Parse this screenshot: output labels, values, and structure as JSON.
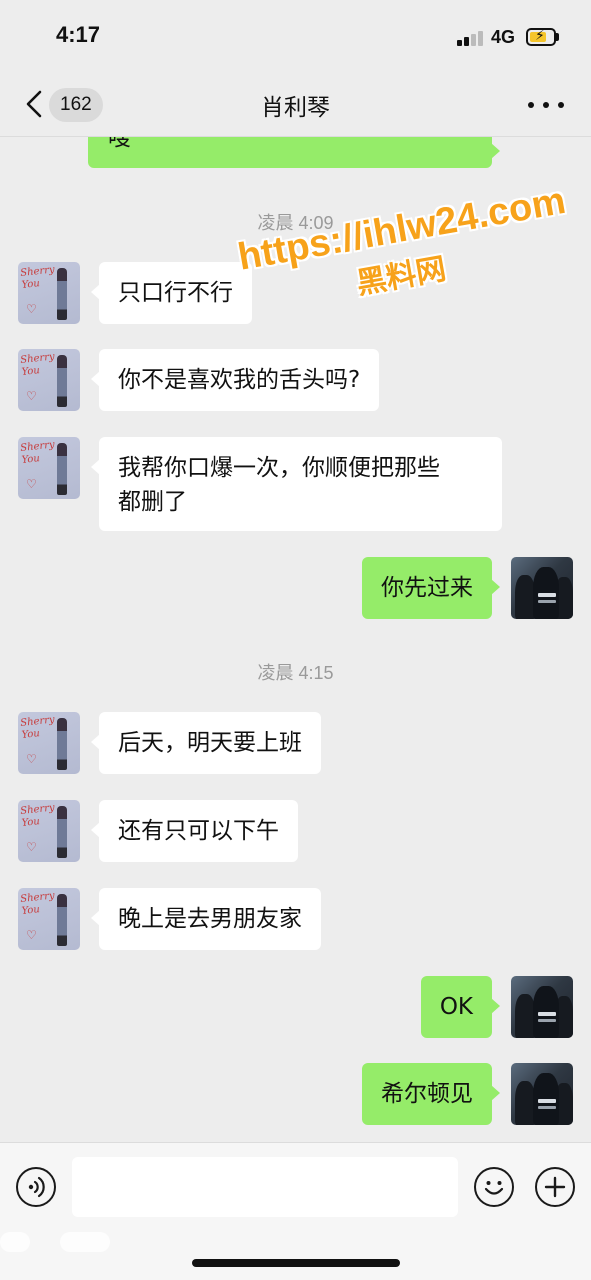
{
  "status_bar": {
    "time": "4:17",
    "network": "4G",
    "battery_charging": true
  },
  "nav": {
    "unread_count": "162",
    "title": "肖利琴"
  },
  "messages": [
    {
      "type": "bubble",
      "side": "out",
      "text": "嗖",
      "partial": true
    },
    {
      "type": "time",
      "text": "凌晨 4:09"
    },
    {
      "type": "bubble",
      "side": "in",
      "text": "只口行不行"
    },
    {
      "type": "bubble",
      "side": "in",
      "text": "你不是喜欢我的舌头吗?"
    },
    {
      "type": "bubble",
      "side": "in",
      "line1": "我帮你口爆一次，你顺便把那些",
      "line2": "都删了"
    },
    {
      "type": "bubble",
      "side": "out",
      "text": "你先过来"
    },
    {
      "type": "time",
      "text": "凌晨 4:15"
    },
    {
      "type": "bubble",
      "side": "in",
      "text": "后天，明天要上班"
    },
    {
      "type": "bubble",
      "side": "in",
      "text": "还有只可以下午"
    },
    {
      "type": "bubble",
      "side": "in",
      "text": "晚上是去男朋友家"
    },
    {
      "type": "bubble",
      "side": "out",
      "text": "OK"
    },
    {
      "type": "bubble",
      "side": "out",
      "text": "希尔顿见"
    }
  ],
  "watermark": {
    "line1": "https://ihlw24.com",
    "line2": "黑料网"
  },
  "input": {
    "value": "",
    "placeholder": ""
  },
  "colors": {
    "background": "#ededed",
    "outgoing_bubble": "#95ec69",
    "incoming_bubble": "#ffffff",
    "watermark": "#f7a21a"
  },
  "icons": {
    "back": "chevron-left-icon",
    "more": "more-dots-icon",
    "voice": "voice-icon",
    "emoji": "emoji-icon",
    "plus": "plus-icon"
  }
}
